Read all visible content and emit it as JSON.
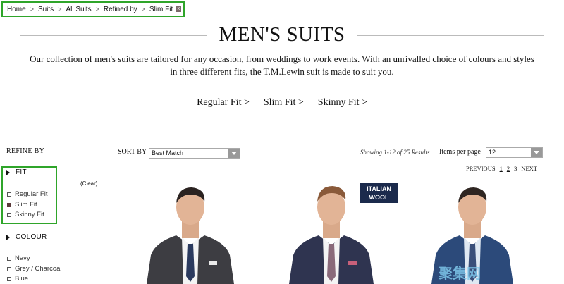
{
  "breadcrumb": {
    "items": [
      "Home",
      "Suits",
      "All Suits",
      "Refined by",
      "Slim Fit"
    ],
    "separator": ">",
    "remove_icon": "x"
  },
  "page": {
    "title": "MEN'S SUITS",
    "description": "Our collection of men's suits are tailored for any occasion, from weddings to work events. With an unrivalled choice of colours and styles in three different fits, the T.M.Lewin suit is made to suit you."
  },
  "fit_links": [
    "Regular Fit >",
    "Slim Fit >",
    "Skinny Fit >"
  ],
  "refine": {
    "heading": "REFINE BY",
    "clear": "(Clear)",
    "fit": {
      "title": "FIT",
      "options": [
        {
          "label": "Regular Fit",
          "checked": false
        },
        {
          "label": "Slim Fit",
          "checked": true
        },
        {
          "label": "Skinny Fit",
          "checked": false
        }
      ]
    },
    "colour": {
      "title": "COLOUR",
      "options": [
        {
          "label": "Navy",
          "checked": false
        },
        {
          "label": "Grey / Charcoal",
          "checked": false
        },
        {
          "label": "Blue",
          "checked": false
        }
      ]
    }
  },
  "sort": {
    "label": "SORT BY",
    "value": "Best Match"
  },
  "results_text": "Showing 1-12 of 25 Results",
  "items_per_page": {
    "label": "Items per page",
    "value": "12"
  },
  "pagination": {
    "previous": "PREVIOUS",
    "pages": [
      "1",
      "2",
      "3"
    ],
    "current": "3",
    "next": "NEXT"
  },
  "products": [
    {
      "badge": "",
      "suit_color": "#3d3d42",
      "tie_color": "#2b3a5e"
    },
    {
      "badge": "ITALIAN WOOL",
      "suit_color": "#2f3450",
      "tie_color": "#8a6a7a"
    },
    {
      "badge": "",
      "suit_color": "#2c4a7a",
      "tie_color": "#3a4f7a"
    }
  ],
  "badge_text": {
    "line1": "ITALIAN",
    "line2": "WOOL"
  },
  "watermark": "聚集网",
  "colors": {
    "highlight_border": "#2fa52a",
    "badge_bg": "#1b2a4c"
  }
}
